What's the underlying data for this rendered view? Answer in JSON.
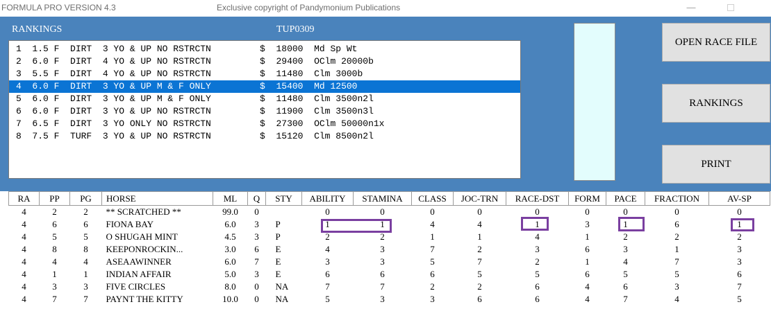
{
  "window": {
    "app_title": "FORMULA PRO VERSION 4.3",
    "copyright": "Exclusive copyright of Pandymonium Publications",
    "minimize": "—"
  },
  "panel": {
    "rankings_label": "RANKINGS",
    "file_label": "TUP0309",
    "selected_index": 3,
    "races": [
      "1  1.5 F  DIRT  3 YO & UP NO RSTRCTN         $  18000  Md Sp Wt",
      "2  6.0 F  DIRT  4 YO & UP NO RSTRCTN         $  29400  OClm 20000b",
      "3  5.5 F  DIRT  4 YO & UP NO RSTRCTN         $  11480  Clm 3000b",
      "4  6.0 F  DIRT  3 YO & UP M & F ONLY         $  15400  Md 12500",
      "5  6.0 F  DIRT  3 YO & UP M & F ONLY         $  11480  Clm 3500n2l",
      "6  6.0 F  DIRT  3 YO & UP NO RSTRCTN         $  11900  Clm 3500n3l",
      "7  6.5 F  DIRT  3 YO ONLY NO RSTRCTN         $  27300  OClm 50000n1x",
      "8  7.5 F  TURF  3 YO & UP NO RSTRCTN         $  15120  Clm 8500n2l"
    ]
  },
  "buttons": {
    "open": "OPEN RACE FILE",
    "rankings": "RANKINGS",
    "print": "PRINT"
  },
  "table": {
    "headers": [
      "RA",
      "PP",
      "PG",
      "HORSE",
      "ML",
      "Q",
      "STY",
      "ABILITY",
      "STAMINA",
      "CLASS",
      "JOC-TRN",
      "RACE-DST",
      "FORM",
      "PACE",
      "FRACTION",
      "AV-SP"
    ],
    "rows": [
      [
        "4",
        "2",
        "2",
        "** SCRATCHED **",
        "99.0",
        "0",
        "",
        "0",
        "0",
        "0",
        "0",
        "0",
        "0",
        "0",
        "0",
        "0"
      ],
      [
        "4",
        "6",
        "6",
        "FIONA BAY",
        "6.0",
        "3",
        "P",
        "1",
        "1",
        "4",
        "4",
        "1",
        "3",
        "1",
        "6",
        "1"
      ],
      [
        "4",
        "5",
        "5",
        "O SHUGAH MINT",
        "4.5",
        "3",
        "P",
        "2",
        "2",
        "1",
        "1",
        "4",
        "1",
        "2",
        "2",
        "2"
      ],
      [
        "4",
        "8",
        "8",
        "KEEPONROCKIN...",
        "3.0",
        "6",
        "E",
        "4",
        "3",
        "7",
        "2",
        "3",
        "6",
        "3",
        "1",
        "3"
      ],
      [
        "4",
        "4",
        "4",
        "ASEAAWINNER",
        "6.0",
        "7",
        "E",
        "3",
        "3",
        "5",
        "7",
        "2",
        "1",
        "4",
        "7",
        "3"
      ],
      [
        "4",
        "1",
        "1",
        "INDIAN AFFAIR",
        "5.0",
        "3",
        "E",
        "6",
        "6",
        "6",
        "5",
        "5",
        "6",
        "5",
        "5",
        "6"
      ],
      [
        "4",
        "3",
        "3",
        "FIVE CIRCLES",
        "8.0",
        "0",
        "NA",
        "7",
        "7",
        "2",
        "2",
        "6",
        "4",
        "6",
        "3",
        "7"
      ],
      [
        "4",
        "7",
        "7",
        "PAYNT THE KITTY",
        "10.0",
        "0",
        "NA",
        "5",
        "3",
        "3",
        "6",
        "6",
        "4",
        "7",
        "4",
        "5"
      ]
    ]
  },
  "highlights": {
    "color": "#7a3fa0"
  }
}
